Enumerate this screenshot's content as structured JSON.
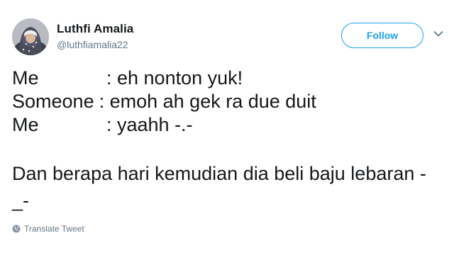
{
  "author": {
    "display_name": "Luthfi Amalia",
    "handle": "@luthfiamalia22",
    "avatar_icon": "avatar-photo"
  },
  "follow_button": {
    "label": "Follow",
    "color": "#1da1f2"
  },
  "menu_icon": "chevron-down-icon",
  "tweet": {
    "dialogue": [
      {
        "speaker": "Me",
        "text": ": eh nonton yuk!"
      },
      {
        "speaker": "Someone",
        "text": ": emoh ah gek ra due duit"
      },
      {
        "speaker": "Me",
        "text": ": yaahh -.-"
      }
    ],
    "paragraph": "Dan berapa hari kemudian dia beli baju lebaran -_-"
  },
  "translate": {
    "label": "Translate Tweet",
    "icon": "globe-icon"
  }
}
